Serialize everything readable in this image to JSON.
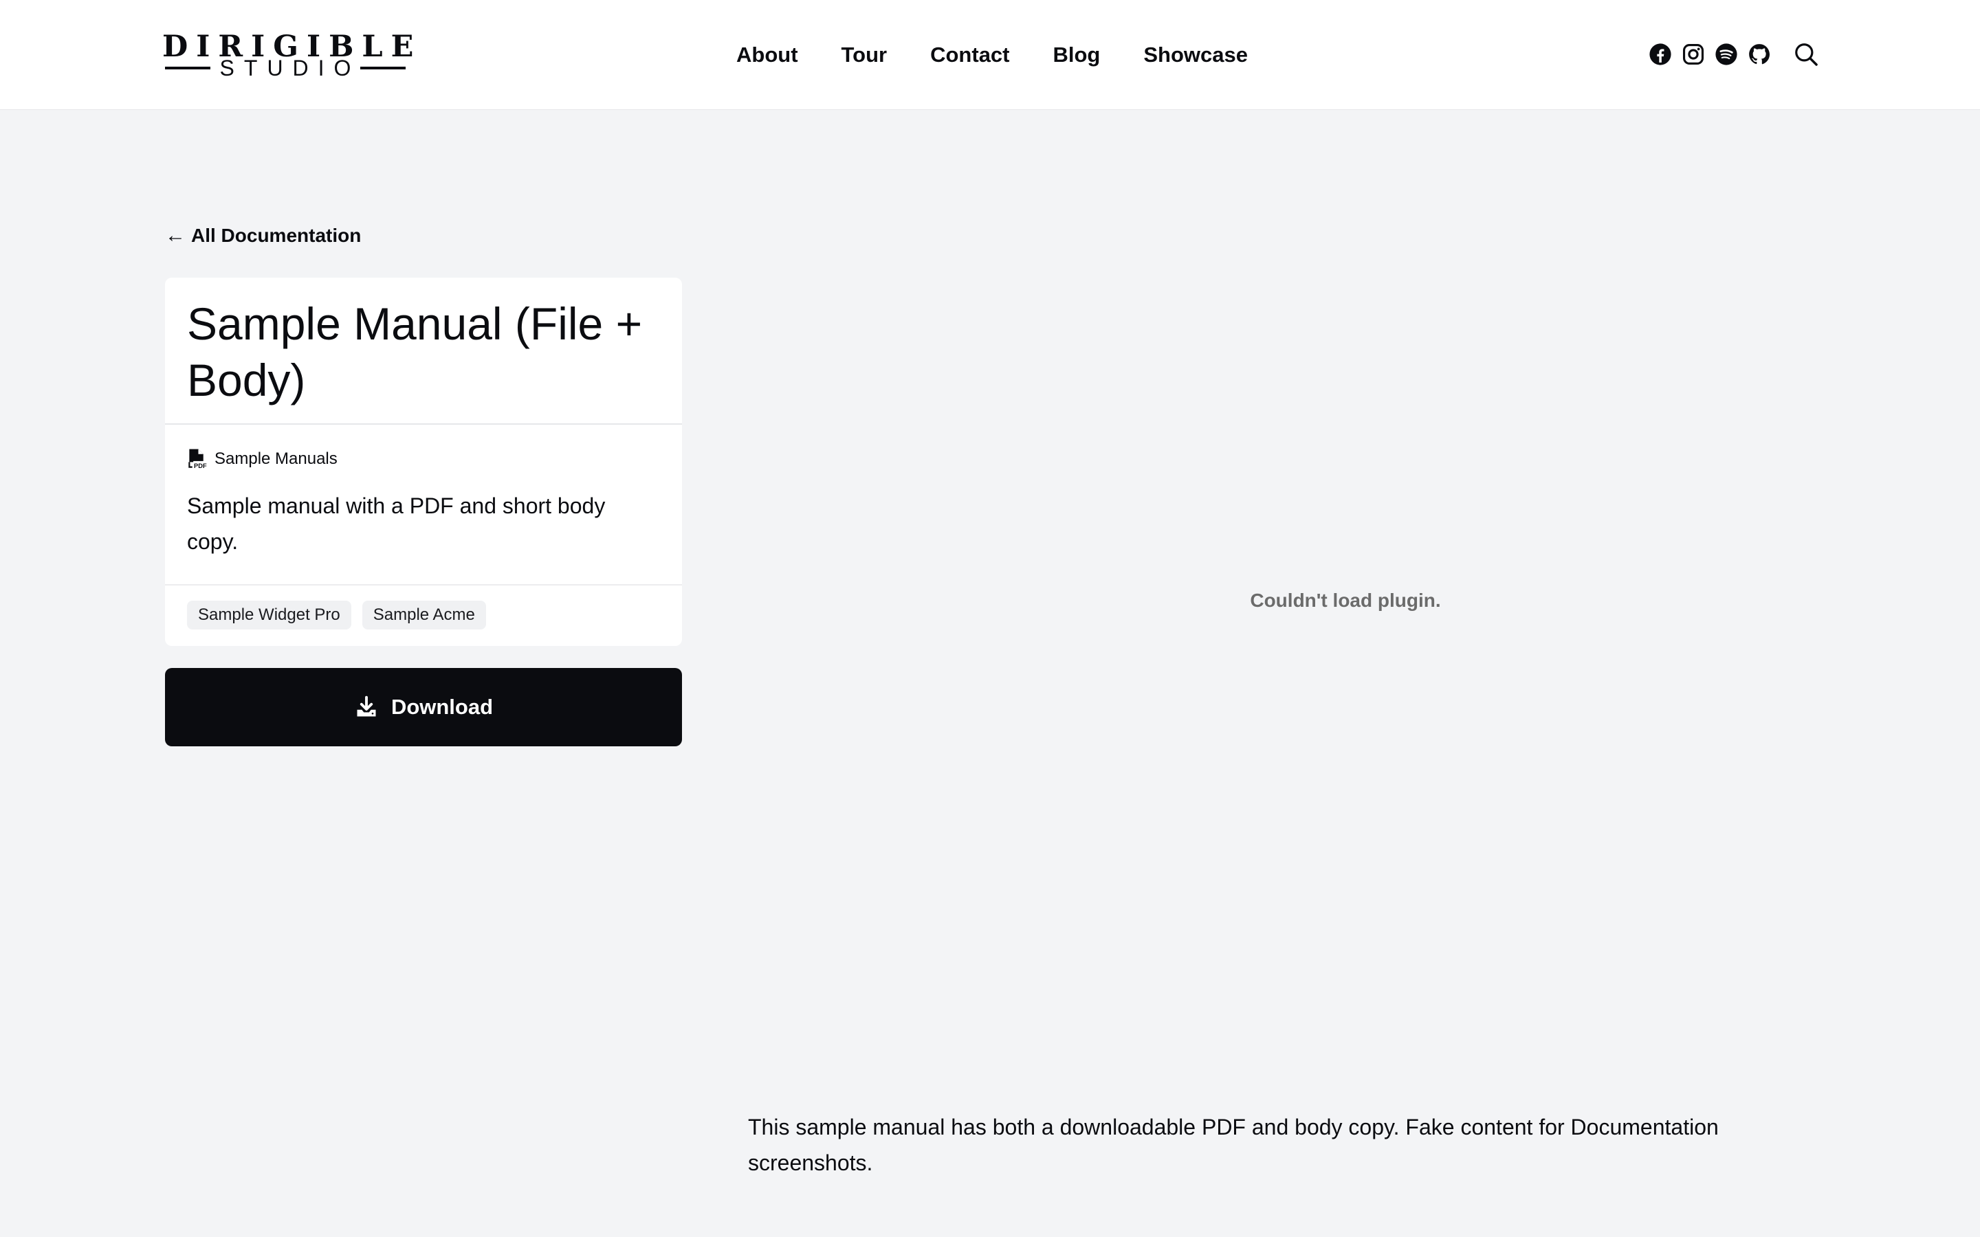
{
  "header": {
    "logo": {
      "top_text": "DIRIGIBLE",
      "bottom_text": "STUDIO"
    },
    "nav": [
      {
        "label": "About"
      },
      {
        "label": "Tour"
      },
      {
        "label": "Contact"
      },
      {
        "label": "Blog"
      },
      {
        "label": "Showcase"
      }
    ],
    "social_icons": [
      "facebook-icon",
      "instagram-icon",
      "spotify-icon",
      "github-icon"
    ],
    "search_icon": "search-icon"
  },
  "back_link": {
    "arrow": "←",
    "label": "All Documentation"
  },
  "card": {
    "title": "Sample Manual (File + Body)",
    "category": {
      "icon": "pdf-file-icon",
      "label": "Sample Manuals"
    },
    "description": "Sample manual with a PDF and short body copy.",
    "tags": [
      "Sample Widget Pro",
      "Sample Acme"
    ]
  },
  "download": {
    "icon": "download-icon",
    "label": "Download"
  },
  "plugin": {
    "message": "Couldn't load plugin."
  },
  "body_copy": "This sample manual has both a downloadable PDF and body copy. Fake content for Documentation screenshots.",
  "colors": {
    "page_background": "#f3f4f6",
    "card_background": "#ffffff",
    "button_background": "#0b0c10",
    "text": "#0b0c10",
    "plugin_message": "#6b6b6b"
  }
}
